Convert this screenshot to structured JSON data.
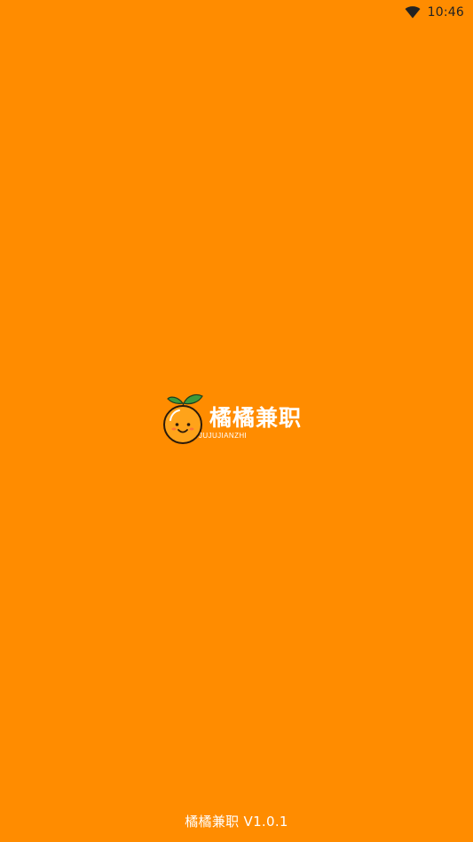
{
  "status_bar": {
    "time": "10:46",
    "wifi_icon": "wifi-icon"
  },
  "logo": {
    "icon": "orange-fruit-icon",
    "title_cn": "橘橘兼职",
    "title_en": "JUJUJIANZHI"
  },
  "footer": {
    "version_text": "橘橘兼职 V1.0.1"
  },
  "colors": {
    "background": "#FF8C00",
    "text": "#FFFFFF",
    "status_icons": "#222222"
  }
}
